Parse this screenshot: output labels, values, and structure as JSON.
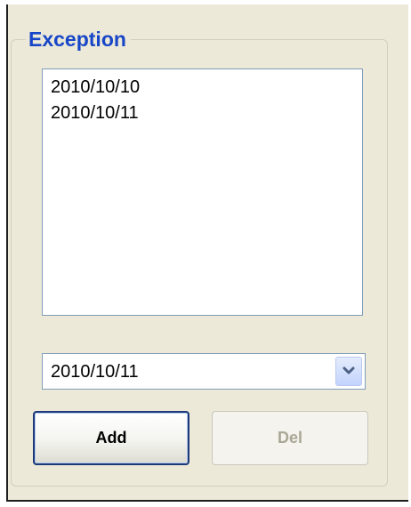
{
  "exception": {
    "title": "Exception",
    "list_items": [
      "2010/10/10",
      "2010/10/11"
    ],
    "combo": {
      "selected_value": "2010/10/11",
      "dropdown_icon": "chevron-down-icon"
    },
    "buttons": {
      "add_label": "Add",
      "del_label": "Del",
      "del_enabled": false
    }
  },
  "colors": {
    "title_text": "#1846c8",
    "panel_background": "#ece9d8",
    "field_border": "#7f9db9",
    "disabled_text": "#a9a896"
  }
}
